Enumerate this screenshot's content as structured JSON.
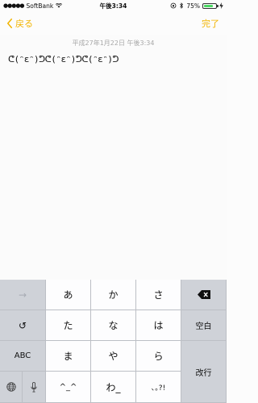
{
  "status_bar": {
    "carrier": "SoftBank",
    "signal": "●●●●●",
    "time": "午後3:34",
    "battery_percent": "75%",
    "battery_level": 0.75
  },
  "nav": {
    "back_label": "戻る",
    "done_label": "完了"
  },
  "note": {
    "date": "平成27年1月22日 午後3:34",
    "text": "ᕦ(ᵔεᵔ)ᕤᕦ(ᵔεᵔ)ᕤᕦ(ᵔεᵔ)ᕤ"
  },
  "keyboard": {
    "arrow": "→",
    "undo": "↺",
    "abc": "ABC",
    "globe": "globe",
    "mic": "mic",
    "k_a": "あ",
    "k_ka": "か",
    "k_sa": "さ",
    "k_ta": "た",
    "k_na": "な",
    "k_ha": "は",
    "k_ma": "ま",
    "k_ya": "や",
    "k_ra": "ら",
    "k_emoticon": "^_^",
    "k_wa": "わ_",
    "k_punct": "､｡?!",
    "space": "空白",
    "return": "改行"
  },
  "colors": {
    "accent": "#f2b400",
    "keyboard_bg": "#c9ccd2",
    "key_light": "#fdfdfe",
    "key_dark": "#cfd2d8"
  }
}
